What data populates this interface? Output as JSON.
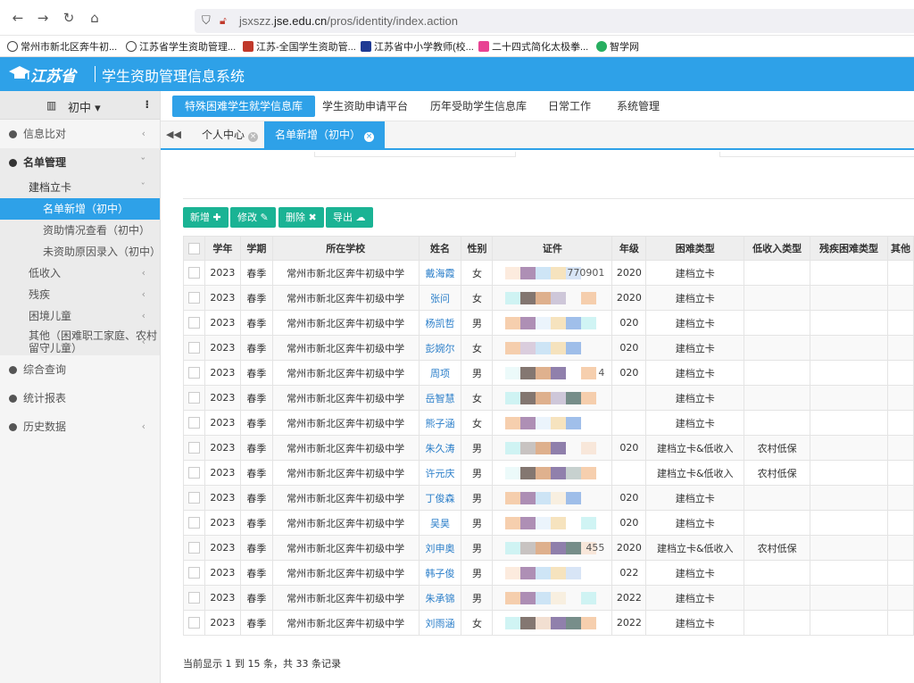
{
  "browser": {
    "url_prefix": "jsxszz.",
    "url_domain": "jse.edu.cn",
    "url_path": "/pros/identity/index.action",
    "bookmarks": [
      {
        "label": "常州市新北区奔牛初...",
        "icon": "globe-icon",
        "color": "#444444"
      },
      {
        "label": "江苏省学生资助管理...",
        "icon": "globe-icon",
        "color": "#444444"
      },
      {
        "label": "江苏-全国学生资助管...",
        "icon": "badge-icon",
        "color": "#c0392b"
      },
      {
        "label": "江苏省中小学教师(校...",
        "icon": "school-icon",
        "color": "#1f3a93"
      },
      {
        "label": "二十四式简化太极拳...",
        "icon": "play-icon",
        "color": "#e84393"
      },
      {
        "label": "智学网",
        "icon": "cloud-icon",
        "color": "#27ae60"
      }
    ]
  },
  "header": {
    "logo_text": "江苏省",
    "title": "学生资助管理信息系统"
  },
  "sidebar": {
    "grade": "初中",
    "menu": [
      {
        "label": "信息比对"
      },
      {
        "label": "名单管理"
      },
      {
        "label": "综合查询"
      },
      {
        "label": "统计报表"
      },
      {
        "label": "历史数据"
      }
    ],
    "group": "建档立卡",
    "sub_items": [
      "名单新增（初中）",
      "资助情况查看（初中）",
      "未资助原因录入（初中）"
    ],
    "other_items": [
      "低收入",
      "残疾",
      "困境儿童",
      "其他（困难职工家庭、农村",
      "留守儿童）"
    ]
  },
  "topnav": [
    "特殊困难学生就学信息库",
    "学生资助申请平台",
    "历年受助学生信息库",
    "日常工作",
    "系统管理"
  ],
  "tabs": [
    "个人中心",
    "名单新增（初中）"
  ],
  "toolbar": {
    "add": "新增 ✚",
    "edit": "修改 ✎",
    "delete": "删除 ✖",
    "export": "导出 ☁"
  },
  "table": {
    "headers": [
      "学年",
      "学期",
      "所在学校",
      "姓名",
      "性别",
      "证件",
      "年级",
      "困难类型",
      "低收入类型",
      "残疾困难类型",
      "其他"
    ],
    "rows": [
      {
        "year": "2023",
        "term": "春季",
        "school": "常州市新北区奔牛初级中学",
        "name": "戴海霞",
        "sex": "女",
        "id": "770901",
        "grade": "2020",
        "type": "建档立卡",
        "low": "",
        "dis": ""
      },
      {
        "year": "2023",
        "term": "春季",
        "school": "常州市新北区奔牛初级中学",
        "name": "张问",
        "sex": "女",
        "id": "",
        "grade": "2020",
        "type": "建档立卡",
        "low": "",
        "dis": ""
      },
      {
        "year": "2023",
        "term": "春季",
        "school": "常州市新北区奔牛初级中学",
        "name": "杨凯哲",
        "sex": "男",
        "id": "",
        "grade": "020",
        "type": "建档立卡",
        "low": "",
        "dis": ""
      },
      {
        "year": "2023",
        "term": "春季",
        "school": "常州市新北区奔牛初级中学",
        "name": "彭婉尔",
        "sex": "女",
        "id": "",
        "grade": "020",
        "type": "建档立卡",
        "low": "",
        "dis": ""
      },
      {
        "year": "2023",
        "term": "春季",
        "school": "常州市新北区奔牛初级中学",
        "name": "周项",
        "sex": "男",
        "id": "4",
        "grade": "020",
        "type": "建档立卡",
        "low": "",
        "dis": ""
      },
      {
        "year": "2023",
        "term": "春季",
        "school": "常州市新北区奔牛初级中学",
        "name": "岳智慧",
        "sex": "女",
        "id": "",
        "grade": "",
        "type": "建档立卡",
        "low": "",
        "dis": ""
      },
      {
        "year": "2023",
        "term": "春季",
        "school": "常州市新北区奔牛初级中学",
        "name": "熊子涵",
        "sex": "女",
        "id": "",
        "grade": "",
        "type": "建档立卡",
        "low": "",
        "dis": ""
      },
      {
        "year": "2023",
        "term": "春季",
        "school": "常州市新北区奔牛初级中学",
        "name": "朱久涛",
        "sex": "男",
        "id": "",
        "grade": "020",
        "type": "建档立卡&低收入",
        "low": "农村低保",
        "dis": ""
      },
      {
        "year": "2023",
        "term": "春季",
        "school": "常州市新北区奔牛初级中学",
        "name": "许元庆",
        "sex": "男",
        "id": "",
        "grade": "",
        "type": "建档立卡&低收入",
        "low": "农村低保",
        "dis": ""
      },
      {
        "year": "2023",
        "term": "春季",
        "school": "常州市新北区奔牛初级中学",
        "name": "丁俊森",
        "sex": "男",
        "id": "",
        "grade": "020",
        "type": "建档立卡",
        "low": "",
        "dis": ""
      },
      {
        "year": "2023",
        "term": "春季",
        "school": "常州市新北区奔牛初级中学",
        "name": "吴昊",
        "sex": "男",
        "id": "",
        "grade": "020",
        "type": "建档立卡",
        "low": "",
        "dis": ""
      },
      {
        "year": "2023",
        "term": "春季",
        "school": "常州市新北区奔牛初级中学",
        "name": "刘申奥",
        "sex": "男",
        "id": "455",
        "grade": "2020",
        "type": "建档立卡&低收入",
        "low": "农村低保",
        "dis": ""
      },
      {
        "year": "2023",
        "term": "春季",
        "school": "常州市新北区奔牛初级中学",
        "name": "韩子俊",
        "sex": "男",
        "id": "",
        "grade": "022",
        "type": "建档立卡",
        "low": "",
        "dis": ""
      },
      {
        "year": "2023",
        "term": "春季",
        "school": "常州市新北区奔牛初级中学",
        "name": "朱承锦",
        "sex": "男",
        "id": "",
        "grade": "2022",
        "type": "建档立卡",
        "low": "",
        "dis": ""
      },
      {
        "year": "2023",
        "term": "春季",
        "school": "常州市新北区奔牛初级中学",
        "name": "刘雨涵",
        "sex": "女",
        "id": "",
        "grade": "2022",
        "type": "建档立卡",
        "low": "",
        "dis": ""
      }
    ]
  },
  "pagination": {
    "text": "当前显示 1 到 15 条，共 33 条记录"
  },
  "colors": {
    "primary": "#2ea1e8",
    "button": "#1ab394",
    "link": "#2a7ec9"
  }
}
